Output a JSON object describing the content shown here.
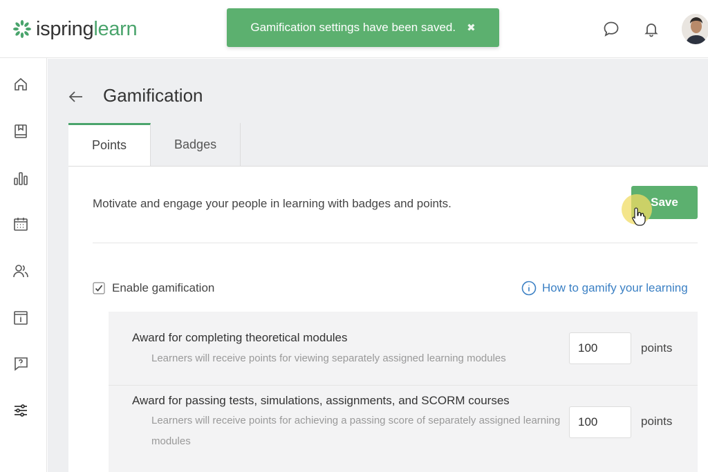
{
  "logo": {
    "part1": "ispring",
    "part2": "learn",
    "brand_color": "#4aa46c"
  },
  "toast": {
    "message": "Gamification settings have been saved.",
    "close_icon": "close-icon",
    "color": "#5cb06f"
  },
  "topbar": {
    "icons": [
      "chat-bubble-icon",
      "bell-icon"
    ],
    "avatar": "user-avatar"
  },
  "sidebar": {
    "items": [
      {
        "icon": "home-icon"
      },
      {
        "icon": "book-icon"
      },
      {
        "icon": "bar-chart-icon"
      },
      {
        "icon": "calendar-icon"
      },
      {
        "icon": "users-icon"
      },
      {
        "icon": "info-card-icon"
      },
      {
        "icon": "help-chat-icon"
      },
      {
        "icon": "sliders-icon",
        "active": true
      }
    ]
  },
  "page": {
    "title": "Gamification",
    "back_icon": "back-arrow-icon"
  },
  "tabs": [
    {
      "label": "Points",
      "active": true
    },
    {
      "label": "Badges",
      "active": false
    }
  ],
  "points": {
    "intro": "Motivate and engage your people in learning with badges and points.",
    "save_label": "Save",
    "enable_label": "Enable gamification",
    "enable_checked": true,
    "howto_label": "How to gamify your learning",
    "settings": [
      {
        "title": "Award for completing theoretical modules",
        "description": "Learners will receive points for viewing separately assigned learning modules",
        "value": "100",
        "unit": "points"
      },
      {
        "title": "Award for passing tests, simulations, assignments, and SCORM courses",
        "description": "Learners will receive points for achieving a passing score of separately assigned learning modules",
        "value": "100",
        "unit": "points"
      }
    ]
  },
  "colors": {
    "accent": "#5cb06f",
    "link": "#3b80c4"
  }
}
